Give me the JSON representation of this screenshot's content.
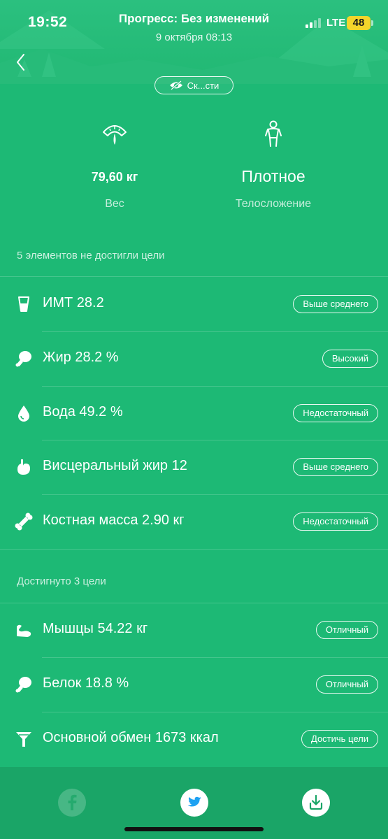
{
  "status_bar": {
    "time": "19:52",
    "network": "LTE",
    "battery": "48"
  },
  "header": {
    "title": "Прогресс: Без изменений",
    "date": "9 октября 08:13",
    "hide_button_label": "Ск...сти"
  },
  "summary": {
    "weight_value": "79,60 кг",
    "weight_label": "Вес",
    "body_type_value": "Плотное",
    "body_type_label": "Телосложение"
  },
  "not_reached": {
    "header": "5 элементов не достигли цели",
    "items": [
      {
        "label": "ИМТ 28.2",
        "badge": "Выше среднего",
        "icon": "glass-icon"
      },
      {
        "label": "Жир 28.2 %",
        "badge": "Высокий",
        "icon": "drumstick-icon"
      },
      {
        "label": "Вода 49.2 %",
        "badge": "Недостаточный",
        "icon": "water-drop-icon"
      },
      {
        "label": "Висцеральный жир 12",
        "badge": "Выше среднего",
        "icon": "stomach-icon"
      },
      {
        "label": "Костная масса 2.90 кг",
        "badge": "Недостаточный",
        "icon": "bone-icon"
      }
    ]
  },
  "reached": {
    "header": "Достигнуто 3 цели",
    "items": [
      {
        "label": "Мышцы 54.22 кг",
        "badge": "Отличный",
        "icon": "muscle-icon"
      },
      {
        "label": "Белок 18.8 %",
        "badge": "Отличный",
        "icon": "drumstick-icon"
      },
      {
        "label": "Основной обмен 1673 ккал",
        "badge": "Достичь цели",
        "icon": "funnel-icon"
      }
    ]
  },
  "share": {
    "icons": [
      "facebook-icon",
      "twitter-icon",
      "download-icon"
    ]
  },
  "colors": {
    "background": "#1db975",
    "bottom_bar": "#1aa567",
    "battery": "#f4d52b",
    "twitter": "#1da1f2"
  }
}
